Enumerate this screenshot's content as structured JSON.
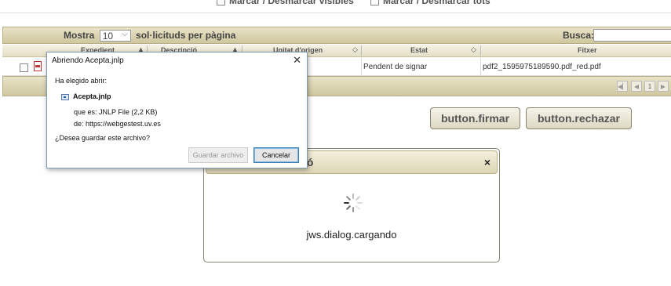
{
  "toolbar": {
    "mark_visible": "Marcar / Desmarcar visibles",
    "mark_all": "Marcar / Desmarcar tots"
  },
  "grid": {
    "mostra_label": "Mostra",
    "page_size": "10",
    "per_page_label": "sol·licituds per pàgina",
    "search_label": "Busca:",
    "columns": [
      "Expedient",
      "Descripció",
      "Unitat d'origen",
      "Estat",
      "Fitxer"
    ],
    "rows": [
      {
        "estat": "Pendent de signar",
        "fitxer": "pdf2_1595975189590.pdf_red.pdf"
      }
    ],
    "current_page": "1"
  },
  "actions": {
    "sign": "button.firmar",
    "reject": "button.rechazar"
  },
  "loading_dialog": {
    "title_fragment": "ió",
    "close": "×",
    "message": "jws.dialog.cargando"
  },
  "file_dialog": {
    "title": "Abriendo Acepta.jnlp",
    "close": "✕",
    "chosen": "Ha elegido abrir:",
    "filename": "Acepta.jnlp",
    "type": "que es: JNLP File (2,2 KB)",
    "from": "de: https://webgestest.uv.es",
    "question": "¿Desea guardar este archivo?",
    "save_button": "Guardar archivo",
    "cancel_button": "Cancelar"
  },
  "colors": {
    "header": "#cfc79f",
    "accent": "#3c7fb1"
  }
}
